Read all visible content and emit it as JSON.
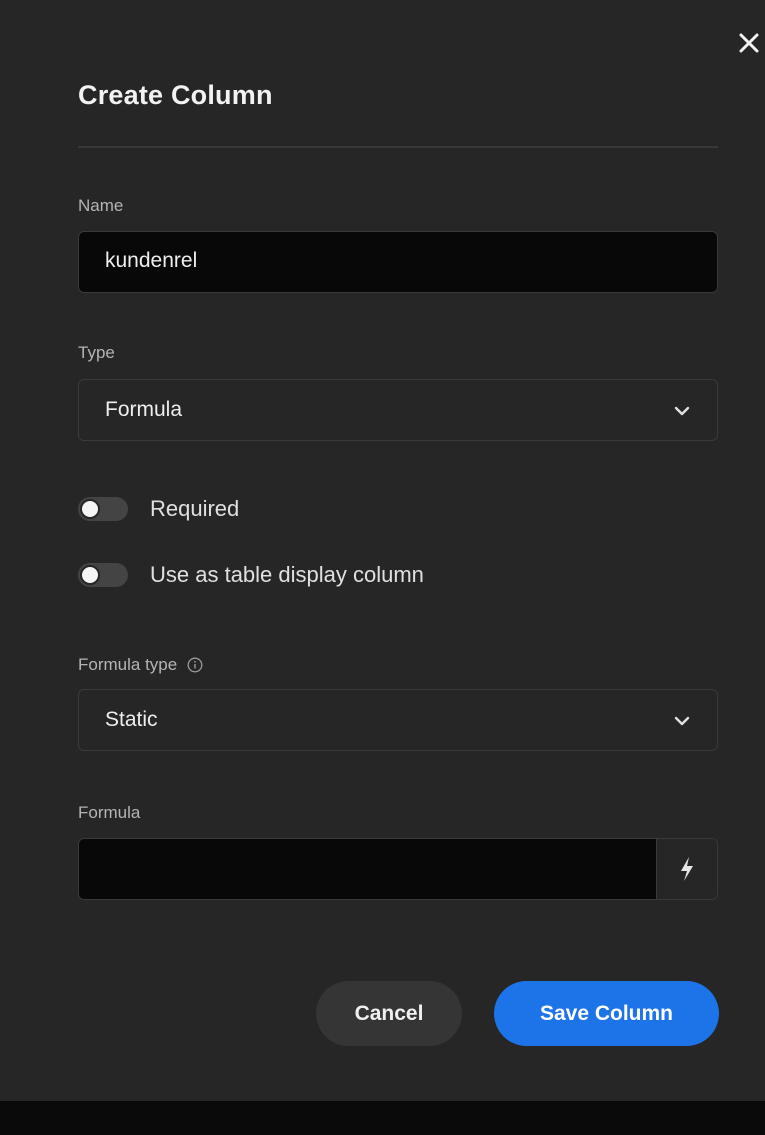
{
  "dialog": {
    "title": "Create Column"
  },
  "name_field": {
    "label": "Name",
    "value": "kundenrel"
  },
  "type_field": {
    "label": "Type",
    "value": "Formula"
  },
  "toggles": {
    "required": {
      "label": "Required",
      "on": false
    },
    "display_column": {
      "label": "Use as table display column",
      "on": false
    }
  },
  "formula_type_field": {
    "label": "Formula type",
    "value": "Static"
  },
  "formula_field": {
    "label": "Formula",
    "value": ""
  },
  "buttons": {
    "cancel": "Cancel",
    "save": "Save Column"
  },
  "icons": {
    "close": "close-icon",
    "chevron": "chevron-down-icon",
    "info": "info-icon",
    "lightning": "lightning-icon"
  },
  "colors": {
    "background": "#262626",
    "input_bg": "#080808",
    "accent": "#1d73e8",
    "cancel_bg": "#353535"
  }
}
